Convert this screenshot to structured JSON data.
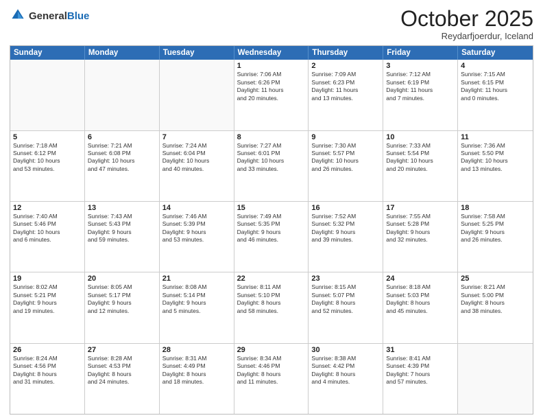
{
  "logo": {
    "text_general": "General",
    "text_blue": "Blue"
  },
  "header": {
    "month": "October 2025",
    "location": "Reydarfjoerdur, Iceland"
  },
  "weekdays": [
    "Sunday",
    "Monday",
    "Tuesday",
    "Wednesday",
    "Thursday",
    "Friday",
    "Saturday"
  ],
  "rows": [
    [
      {
        "day": "",
        "lines": []
      },
      {
        "day": "",
        "lines": []
      },
      {
        "day": "",
        "lines": []
      },
      {
        "day": "1",
        "lines": [
          "Sunrise: 7:06 AM",
          "Sunset: 6:26 PM",
          "Daylight: 11 hours",
          "and 20 minutes."
        ]
      },
      {
        "day": "2",
        "lines": [
          "Sunrise: 7:09 AM",
          "Sunset: 6:23 PM",
          "Daylight: 11 hours",
          "and 13 minutes."
        ]
      },
      {
        "day": "3",
        "lines": [
          "Sunrise: 7:12 AM",
          "Sunset: 6:19 PM",
          "Daylight: 11 hours",
          "and 7 minutes."
        ]
      },
      {
        "day": "4",
        "lines": [
          "Sunrise: 7:15 AM",
          "Sunset: 6:15 PM",
          "Daylight: 11 hours",
          "and 0 minutes."
        ]
      }
    ],
    [
      {
        "day": "5",
        "lines": [
          "Sunrise: 7:18 AM",
          "Sunset: 6:12 PM",
          "Daylight: 10 hours",
          "and 53 minutes."
        ]
      },
      {
        "day": "6",
        "lines": [
          "Sunrise: 7:21 AM",
          "Sunset: 6:08 PM",
          "Daylight: 10 hours",
          "and 47 minutes."
        ]
      },
      {
        "day": "7",
        "lines": [
          "Sunrise: 7:24 AM",
          "Sunset: 6:04 PM",
          "Daylight: 10 hours",
          "and 40 minutes."
        ]
      },
      {
        "day": "8",
        "lines": [
          "Sunrise: 7:27 AM",
          "Sunset: 6:01 PM",
          "Daylight: 10 hours",
          "and 33 minutes."
        ]
      },
      {
        "day": "9",
        "lines": [
          "Sunrise: 7:30 AM",
          "Sunset: 5:57 PM",
          "Daylight: 10 hours",
          "and 26 minutes."
        ]
      },
      {
        "day": "10",
        "lines": [
          "Sunrise: 7:33 AM",
          "Sunset: 5:54 PM",
          "Daylight: 10 hours",
          "and 20 minutes."
        ]
      },
      {
        "day": "11",
        "lines": [
          "Sunrise: 7:36 AM",
          "Sunset: 5:50 PM",
          "Daylight: 10 hours",
          "and 13 minutes."
        ]
      }
    ],
    [
      {
        "day": "12",
        "lines": [
          "Sunrise: 7:40 AM",
          "Sunset: 5:46 PM",
          "Daylight: 10 hours",
          "and 6 minutes."
        ]
      },
      {
        "day": "13",
        "lines": [
          "Sunrise: 7:43 AM",
          "Sunset: 5:43 PM",
          "Daylight: 9 hours",
          "and 59 minutes."
        ]
      },
      {
        "day": "14",
        "lines": [
          "Sunrise: 7:46 AM",
          "Sunset: 5:39 PM",
          "Daylight: 9 hours",
          "and 53 minutes."
        ]
      },
      {
        "day": "15",
        "lines": [
          "Sunrise: 7:49 AM",
          "Sunset: 5:35 PM",
          "Daylight: 9 hours",
          "and 46 minutes."
        ]
      },
      {
        "day": "16",
        "lines": [
          "Sunrise: 7:52 AM",
          "Sunset: 5:32 PM",
          "Daylight: 9 hours",
          "and 39 minutes."
        ]
      },
      {
        "day": "17",
        "lines": [
          "Sunrise: 7:55 AM",
          "Sunset: 5:28 PM",
          "Daylight: 9 hours",
          "and 32 minutes."
        ]
      },
      {
        "day": "18",
        "lines": [
          "Sunrise: 7:58 AM",
          "Sunset: 5:25 PM",
          "Daylight: 9 hours",
          "and 26 minutes."
        ]
      }
    ],
    [
      {
        "day": "19",
        "lines": [
          "Sunrise: 8:02 AM",
          "Sunset: 5:21 PM",
          "Daylight: 9 hours",
          "and 19 minutes."
        ]
      },
      {
        "day": "20",
        "lines": [
          "Sunrise: 8:05 AM",
          "Sunset: 5:17 PM",
          "Daylight: 9 hours",
          "and 12 minutes."
        ]
      },
      {
        "day": "21",
        "lines": [
          "Sunrise: 8:08 AM",
          "Sunset: 5:14 PM",
          "Daylight: 9 hours",
          "and 5 minutes."
        ]
      },
      {
        "day": "22",
        "lines": [
          "Sunrise: 8:11 AM",
          "Sunset: 5:10 PM",
          "Daylight: 8 hours",
          "and 58 minutes."
        ]
      },
      {
        "day": "23",
        "lines": [
          "Sunrise: 8:15 AM",
          "Sunset: 5:07 PM",
          "Daylight: 8 hours",
          "and 52 minutes."
        ]
      },
      {
        "day": "24",
        "lines": [
          "Sunrise: 8:18 AM",
          "Sunset: 5:03 PM",
          "Daylight: 8 hours",
          "and 45 minutes."
        ]
      },
      {
        "day": "25",
        "lines": [
          "Sunrise: 8:21 AM",
          "Sunset: 5:00 PM",
          "Daylight: 8 hours",
          "and 38 minutes."
        ]
      }
    ],
    [
      {
        "day": "26",
        "lines": [
          "Sunrise: 8:24 AM",
          "Sunset: 4:56 PM",
          "Daylight: 8 hours",
          "and 31 minutes."
        ]
      },
      {
        "day": "27",
        "lines": [
          "Sunrise: 8:28 AM",
          "Sunset: 4:53 PM",
          "Daylight: 8 hours",
          "and 24 minutes."
        ]
      },
      {
        "day": "28",
        "lines": [
          "Sunrise: 8:31 AM",
          "Sunset: 4:49 PM",
          "Daylight: 8 hours",
          "and 18 minutes."
        ]
      },
      {
        "day": "29",
        "lines": [
          "Sunrise: 8:34 AM",
          "Sunset: 4:46 PM",
          "Daylight: 8 hours",
          "and 11 minutes."
        ]
      },
      {
        "day": "30",
        "lines": [
          "Sunrise: 8:38 AM",
          "Sunset: 4:42 PM",
          "Daylight: 8 hours",
          "and 4 minutes."
        ]
      },
      {
        "day": "31",
        "lines": [
          "Sunrise: 8:41 AM",
          "Sunset: 4:39 PM",
          "Daylight: 7 hours",
          "and 57 minutes."
        ]
      },
      {
        "day": "",
        "lines": []
      }
    ]
  ]
}
